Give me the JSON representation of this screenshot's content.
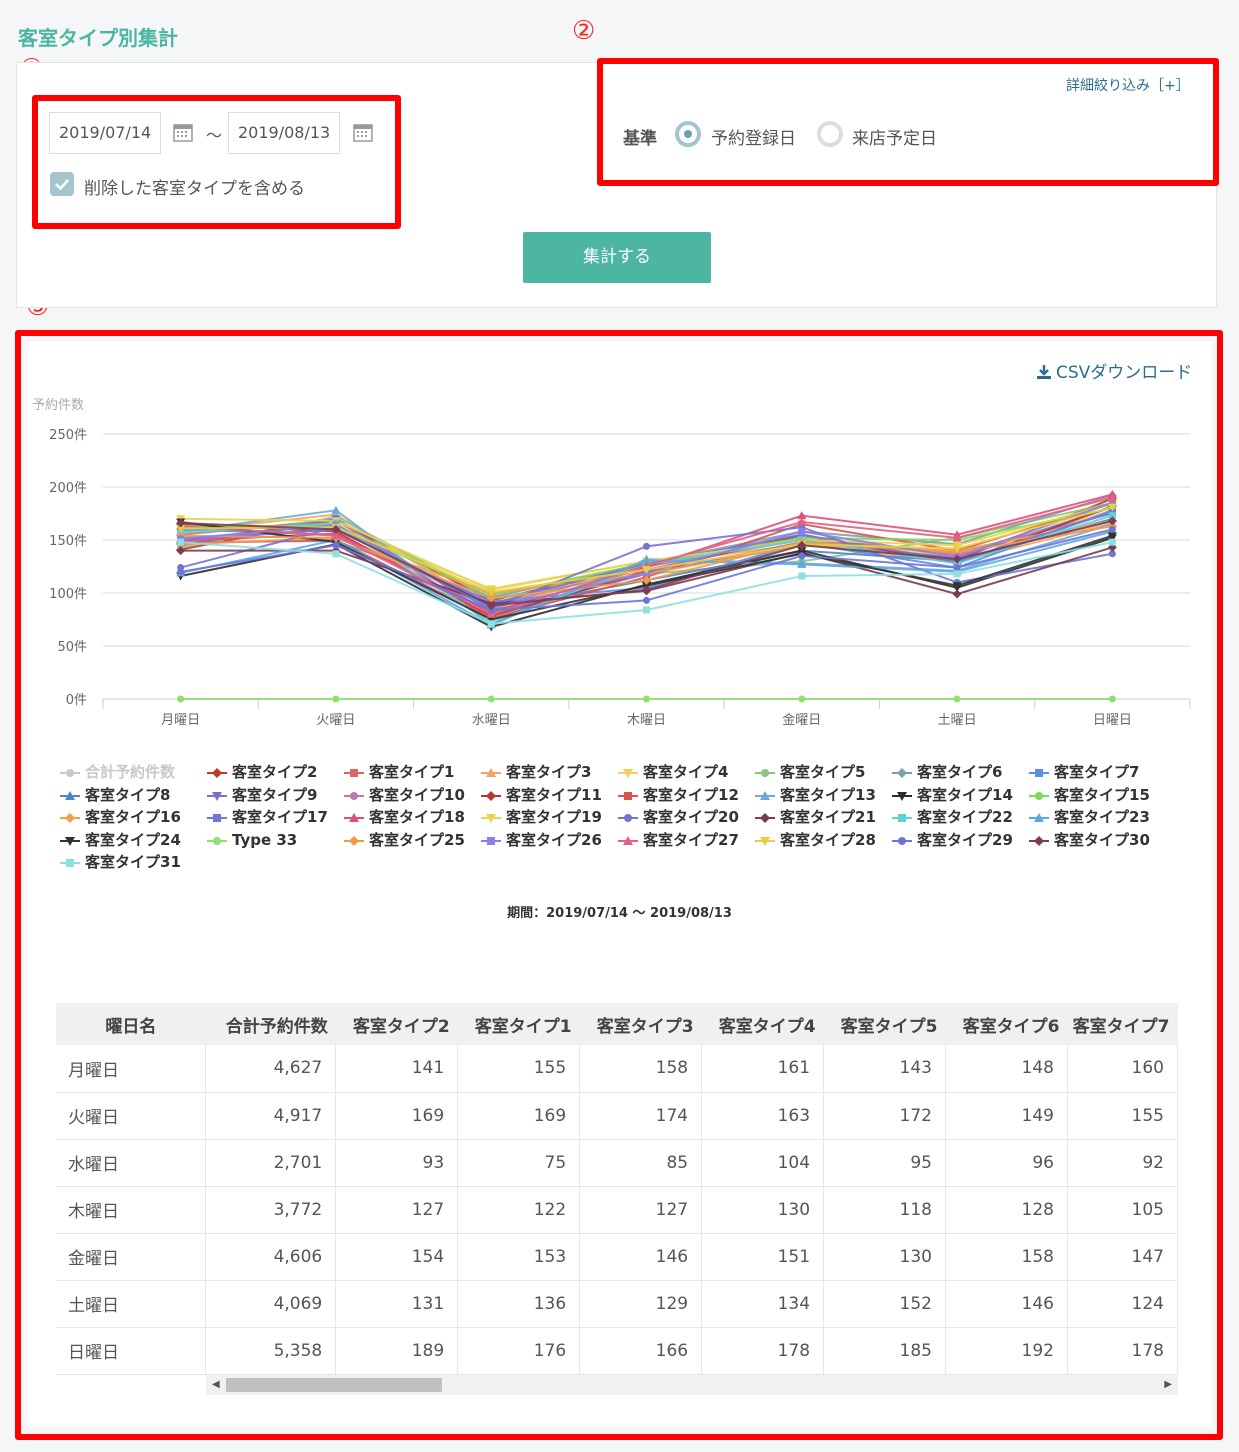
{
  "page_title": "客室タイプ別集計",
  "markers": [
    "①",
    "②",
    "③"
  ],
  "filters": {
    "start_date": "2019/07/14",
    "end_date": "2019/08/13",
    "range_sep": "～",
    "include_deleted_label": "削除した客室タイプを含める",
    "include_deleted_checked": true
  },
  "basis": {
    "detail_link": "詳細絞り込み［+］",
    "label": "基準",
    "options": [
      {
        "label": "予約登録日",
        "selected": true
      },
      {
        "label": "来店予定日",
        "selected": false
      }
    ]
  },
  "submit_label": "集計する",
  "csv_label": "CSVダウンロード",
  "chart_data": {
    "type": "line",
    "ylabel": "予約件数",
    "ylim": [
      0,
      250
    ],
    "yticks": [
      "0件",
      "50件",
      "100件",
      "150件",
      "200件",
      "250件"
    ],
    "categories": [
      "月曜日",
      "火曜日",
      "水曜日",
      "木曜日",
      "金曜日",
      "土曜日",
      "日曜日"
    ],
    "grid": true,
    "legend_position": "bottom",
    "caption": "期間：2019/07/14 ～ 2019/08/13",
    "series": [
      {
        "name": "合計予約件数",
        "hidden": true,
        "color": "#c8c8c8",
        "marker": "circle",
        "values": [
          4627,
          4917,
          2701,
          3772,
          4606,
          4069,
          5358
        ]
      },
      {
        "name": "客室タイプ2",
        "color": "#c0392b",
        "marker": "diamond",
        "values": [
          141,
          169,
          93,
          127,
          154,
          131,
          189
        ]
      },
      {
        "name": "客室タイプ1",
        "color": "#e06666",
        "marker": "square",
        "values": [
          155,
          169,
          75,
          122,
          153,
          136,
          176
        ]
      },
      {
        "name": "客室タイプ3",
        "color": "#f4a460",
        "marker": "triangle",
        "values": [
          158,
          174,
          85,
          127,
          146,
          129,
          166
        ]
      },
      {
        "name": "客室タイプ4",
        "color": "#f1d15a",
        "marker": "triangle-down",
        "values": [
          161,
          163,
          104,
          130,
          151,
          134,
          178
        ]
      },
      {
        "name": "客室タイプ5",
        "color": "#8bc57f",
        "marker": "circle",
        "values": [
          143,
          172,
          95,
          118,
          130,
          152,
          185
        ]
      },
      {
        "name": "客室タイプ6",
        "color": "#7f9fb0",
        "marker": "diamond",
        "values": [
          148,
          149,
          96,
          128,
          158,
          146,
          192
        ]
      },
      {
        "name": "客室タイプ7",
        "color": "#5b8ee6",
        "marker": "square",
        "values": [
          160,
          155,
          92,
          105,
          147,
          124,
          178
        ]
      },
      {
        "name": "客室タイプ8",
        "color": "#4f86c6",
        "marker": "triangle",
        "values": [
          150,
          165,
          84,
          112,
          140,
          130,
          170
        ]
      },
      {
        "name": "客室タイプ9",
        "color": "#7b6fc9",
        "marker": "triangle-down",
        "values": [
          145,
          170,
          80,
          118,
          148,
          133,
          181
        ]
      },
      {
        "name": "客室タイプ10",
        "color": "#b87cae",
        "marker": "circle",
        "values": [
          152,
          160,
          88,
          125,
          150,
          138,
          175
        ]
      },
      {
        "name": "客室タイプ11",
        "color": "#b03a2e",
        "marker": "diamond",
        "values": [
          165,
          158,
          78,
          120,
          155,
          128,
          182
        ]
      },
      {
        "name": "客室タイプ12",
        "color": "#d9534f",
        "marker": "square",
        "values": [
          147,
          150,
          76,
          115,
          165,
          140,
          185
        ]
      },
      {
        "name": "客室タイプ13",
        "color": "#6fa8dc",
        "marker": "triangle",
        "values": [
          158,
          178,
          70,
          132,
          128,
          121,
          165
        ]
      },
      {
        "name": "客室タイプ14",
        "color": "#2d2d2d",
        "marker": "triangle-down",
        "values": [
          116,
          146,
          68,
          108,
          140,
          105,
          152
        ]
      },
      {
        "name": "客室タイプ15",
        "color": "#7ed957",
        "marker": "circle",
        "values": [
          163,
          163,
          98,
          128,
          152,
          150,
          180
        ]
      },
      {
        "name": "客室タイプ16",
        "color": "#f0a04b",
        "marker": "diamond",
        "values": [
          146,
          152,
          100,
          118,
          145,
          140,
          168
        ]
      },
      {
        "name": "客室タイプ17",
        "color": "#6c7ae0",
        "marker": "square",
        "values": [
          150,
          160,
          90,
          128,
          155,
          130,
          176
        ]
      },
      {
        "name": "客室タイプ18",
        "color": "#e0507a",
        "marker": "triangle",
        "values": [
          149,
          156,
          82,
          124,
          173,
          155,
          193
        ]
      },
      {
        "name": "客室タイプ19",
        "color": "#e8d44d",
        "marker": "triangle-down",
        "values": [
          170,
          168,
          103,
          130,
          150,
          145,
          184
        ]
      },
      {
        "name": "客室タイプ20",
        "color": "#7373d6",
        "marker": "circle",
        "values": [
          124,
          162,
          86,
          144,
          162,
          110,
          137
        ]
      },
      {
        "name": "客室タイプ21",
        "color": "#7b3b50",
        "marker": "diamond",
        "values": [
          140,
          140,
          90,
          102,
          138,
          99,
          143
        ]
      },
      {
        "name": "客室タイプ22",
        "color": "#5fd0d3",
        "marker": "square",
        "values": [
          157,
          166,
          72,
          127,
          150,
          128,
          173
        ]
      },
      {
        "name": "客室タイプ23",
        "color": "#5aa9e6",
        "marker": "triangle",
        "values": [
          119,
          150,
          70,
          131,
          127,
          120,
          158
        ]
      },
      {
        "name": "客室タイプ24",
        "color": "#333333",
        "marker": "triangle-down",
        "values": [
          167,
          148,
          75,
          107,
          137,
          107,
          154
        ]
      },
      {
        "name": "Type 33",
        "color": "#90e070",
        "marker": "circle",
        "values": [
          0,
          0,
          0,
          0,
          0,
          0,
          0
        ]
      },
      {
        "name": "客室タイプ25",
        "color": "#f2994a",
        "marker": "diamond",
        "values": [
          154,
          152,
          95,
          112,
          148,
          138,
          163
        ]
      },
      {
        "name": "客室タイプ26",
        "color": "#8b7fe8",
        "marker": "square",
        "values": [
          151,
          164,
          86,
          119,
          158,
          134,
          185
        ]
      },
      {
        "name": "客室タイプ27",
        "color": "#e36080",
        "marker": "triangle",
        "values": [
          163,
          154,
          80,
          126,
          167,
          152,
          190
        ]
      },
      {
        "name": "客室タイプ28",
        "color": "#e6cf3e",
        "marker": "triangle-down",
        "values": [
          161,
          162,
          101,
          122,
          146,
          142,
          181
        ]
      },
      {
        "name": "客室タイプ29",
        "color": "#6b74d8",
        "marker": "circle",
        "values": [
          120,
          145,
          84,
          93,
          135,
          124,
          160
        ]
      },
      {
        "name": "客室タイプ30",
        "color": "#7d3c52",
        "marker": "diamond",
        "values": [
          166,
          160,
          88,
          103,
          145,
          132,
          168
        ]
      },
      {
        "name": "客室タイプ31",
        "color": "#8ee0e0",
        "marker": "square",
        "values": [
          148,
          137,
          71,
          84,
          116,
          118,
          148
        ]
      }
    ]
  },
  "table": {
    "headers": [
      "曜日名",
      "合計予約件数",
      "客室タイプ2",
      "客室タイプ1",
      "客室タイプ3",
      "客室タイプ4",
      "客室タイプ5",
      "客室タイプ6",
      "客室タイプ7"
    ],
    "rows": [
      [
        "月曜日",
        "4,627",
        "141",
        "155",
        "158",
        "161",
        "143",
        "148",
        "160"
      ],
      [
        "火曜日",
        "4,917",
        "169",
        "169",
        "174",
        "163",
        "172",
        "149",
        "155"
      ],
      [
        "水曜日",
        "2,701",
        "93",
        "75",
        "85",
        "104",
        "95",
        "96",
        "92"
      ],
      [
        "木曜日",
        "3,772",
        "127",
        "122",
        "127",
        "130",
        "118",
        "128",
        "105"
      ],
      [
        "金曜日",
        "4,606",
        "154",
        "153",
        "146",
        "151",
        "130",
        "158",
        "147"
      ],
      [
        "土曜日",
        "4,069",
        "131",
        "136",
        "129",
        "134",
        "152",
        "146",
        "124"
      ],
      [
        "日曜日",
        "5,358",
        "189",
        "176",
        "166",
        "178",
        "185",
        "192",
        "178"
      ]
    ]
  }
}
